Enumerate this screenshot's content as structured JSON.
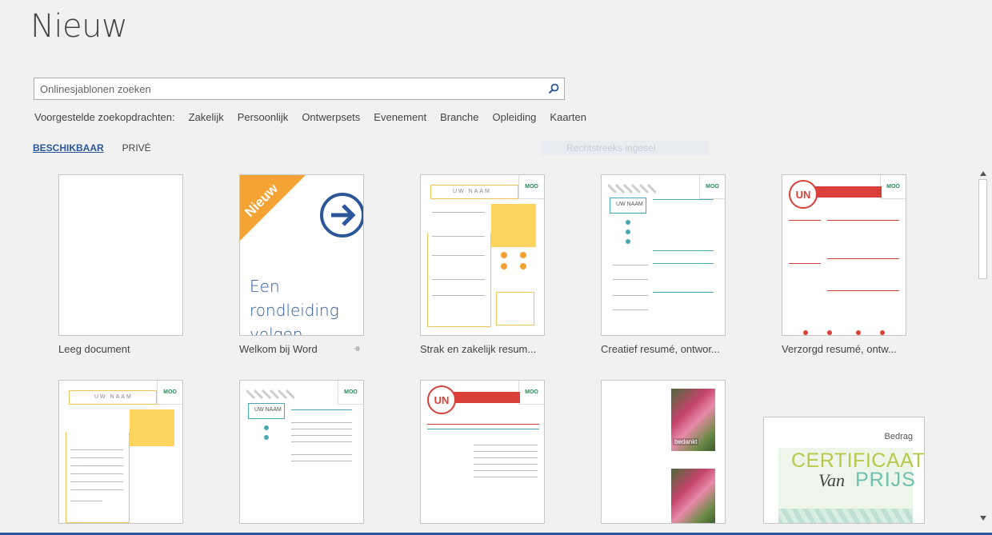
{
  "page": {
    "title": "Nieuw"
  },
  "search": {
    "placeholder": "Onlinesjablonen zoeken",
    "value": ""
  },
  "suggestions": {
    "label": "Voorgestelde zoekopdrachten:",
    "items": [
      "Zakelijk",
      "Persoonlijk",
      "Ontwerpsets",
      "Evenement",
      "Branche",
      "Opleiding",
      "Kaarten"
    ]
  },
  "tabs": [
    {
      "label": "BESCHIKBAAR",
      "active": true
    },
    {
      "label": "PRIVÉ",
      "active": false
    }
  ],
  "faded_option": "Rechtstreeks ingesel",
  "templates": [
    {
      "label": "Leeg document"
    },
    {
      "label": "Welkom bij Word",
      "badge": "Nieuw",
      "body": "Een rondleiding volgen",
      "pin_icon": "pin-icon"
    },
    {
      "label": "Strak en zakelijk resum...",
      "name": "UW NAAM"
    },
    {
      "label": "Creatief resumé, ontwor...",
      "name": "UW NAAM"
    },
    {
      "label": "Verzorgd resumé, ontw...",
      "initials": "UN"
    },
    {
      "label": "",
      "name": "UW NAAM"
    },
    {
      "label": "",
      "name": "UW NAAM"
    },
    {
      "label": "",
      "initials": "UN"
    },
    {
      "label": "",
      "card_text": "bedankt"
    },
    {
      "label": "",
      "cert_corner": "Bedrag",
      "cert_title": "CERTIFICAAT",
      "cert_van": "Van",
      "cert_prijs": "PRIJS"
    }
  ],
  "moo_label": "MOO",
  "colors": {
    "accent": "#2b579a",
    "orange": "#f4a233",
    "yellow": "#fcd45e",
    "red": "#d9403a",
    "teal": "#4aa8b5"
  }
}
